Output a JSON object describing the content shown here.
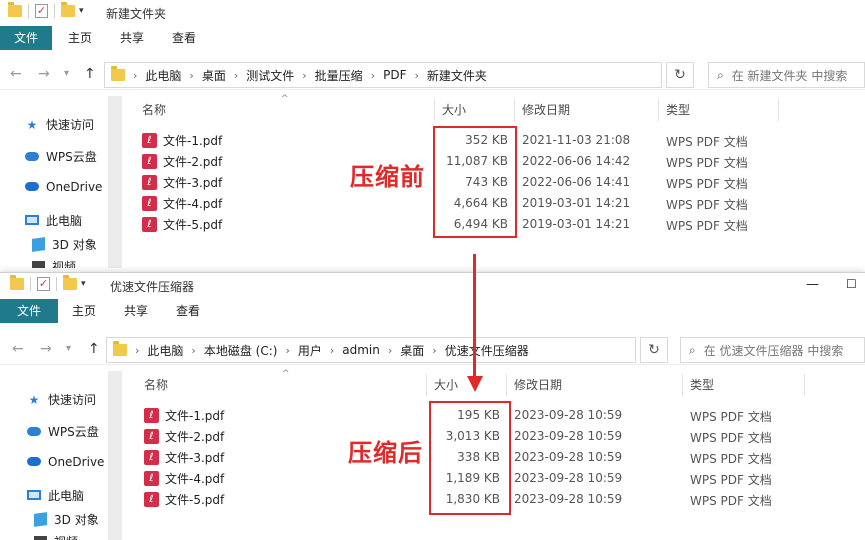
{
  "window1": {
    "title": "新建文件夹",
    "ribbon": [
      "文件",
      "主页",
      "共享",
      "查看"
    ],
    "breadcrumb": [
      "此电脑",
      "桌面",
      "测试文件",
      "批量压缩",
      "PDF",
      "新建文件夹"
    ],
    "search_placeholder": "在 新建文件夹 中搜索",
    "nav": [
      "快速访问",
      "WPS云盘",
      "OneDrive",
      "此电脑",
      "3D 对象",
      "视频"
    ],
    "columns": {
      "name": "名称",
      "size": "大小",
      "date": "修改日期",
      "type": "类型"
    },
    "files": [
      {
        "name": "文件-1.pdf",
        "size": "352 KB",
        "date": "2021-11-03 21:08",
        "type": "WPS PDF 文档"
      },
      {
        "name": "文件-2.pdf",
        "size": "11,087 KB",
        "date": "2022-06-06 14:42",
        "type": "WPS PDF 文档"
      },
      {
        "name": "文件-3.pdf",
        "size": "743 KB",
        "date": "2022-06-06 14:41",
        "type": "WPS PDF 文档"
      },
      {
        "name": "文件-4.pdf",
        "size": "4,664 KB",
        "date": "2019-03-01 14:21",
        "type": "WPS PDF 文档"
      },
      {
        "name": "文件-5.pdf",
        "size": "6,494 KB",
        "date": "2019-03-01 14:21",
        "type": "WPS PDF 文档"
      }
    ],
    "annotation": "压缩前"
  },
  "window2": {
    "title": "优速文件压缩器",
    "ribbon": [
      "文件",
      "主页",
      "共享",
      "查看"
    ],
    "breadcrumb": [
      "此电脑",
      "本地磁盘 (C:)",
      "用户",
      "admin",
      "桌面",
      "优速文件压缩器"
    ],
    "search_placeholder": "在 优速文件压缩器 中搜索",
    "nav": [
      "快速访问",
      "WPS云盘",
      "OneDrive",
      "此电脑",
      "3D 对象",
      "视频"
    ],
    "columns": {
      "name": "名称",
      "size": "大小",
      "date": "修改日期",
      "type": "类型"
    },
    "files": [
      {
        "name": "文件-1.pdf",
        "size": "195 KB",
        "date": "2023-09-28 10:59",
        "type": "WPS PDF 文档"
      },
      {
        "name": "文件-2.pdf",
        "size": "3,013 KB",
        "date": "2023-09-28 10:59",
        "type": "WPS PDF 文档"
      },
      {
        "name": "文件-3.pdf",
        "size": "338 KB",
        "date": "2023-09-28 10:59",
        "type": "WPS PDF 文档"
      },
      {
        "name": "文件-4.pdf",
        "size": "1,189 KB",
        "date": "2023-09-28 10:59",
        "type": "WPS PDF 文档"
      },
      {
        "name": "文件-5.pdf",
        "size": "1,830 KB",
        "date": "2023-09-28 10:59",
        "type": "WPS PDF 文档"
      }
    ],
    "annotation": "压缩后"
  },
  "icons": {
    "pdf": "pdf-file-icon",
    "folder": "folder-icon",
    "search": "search-icon",
    "refresh": "refresh-icon"
  },
  "colors": {
    "accent": "#1f7a8c",
    "highlight": "#e02a2a",
    "pdf": "#d32d4a"
  }
}
